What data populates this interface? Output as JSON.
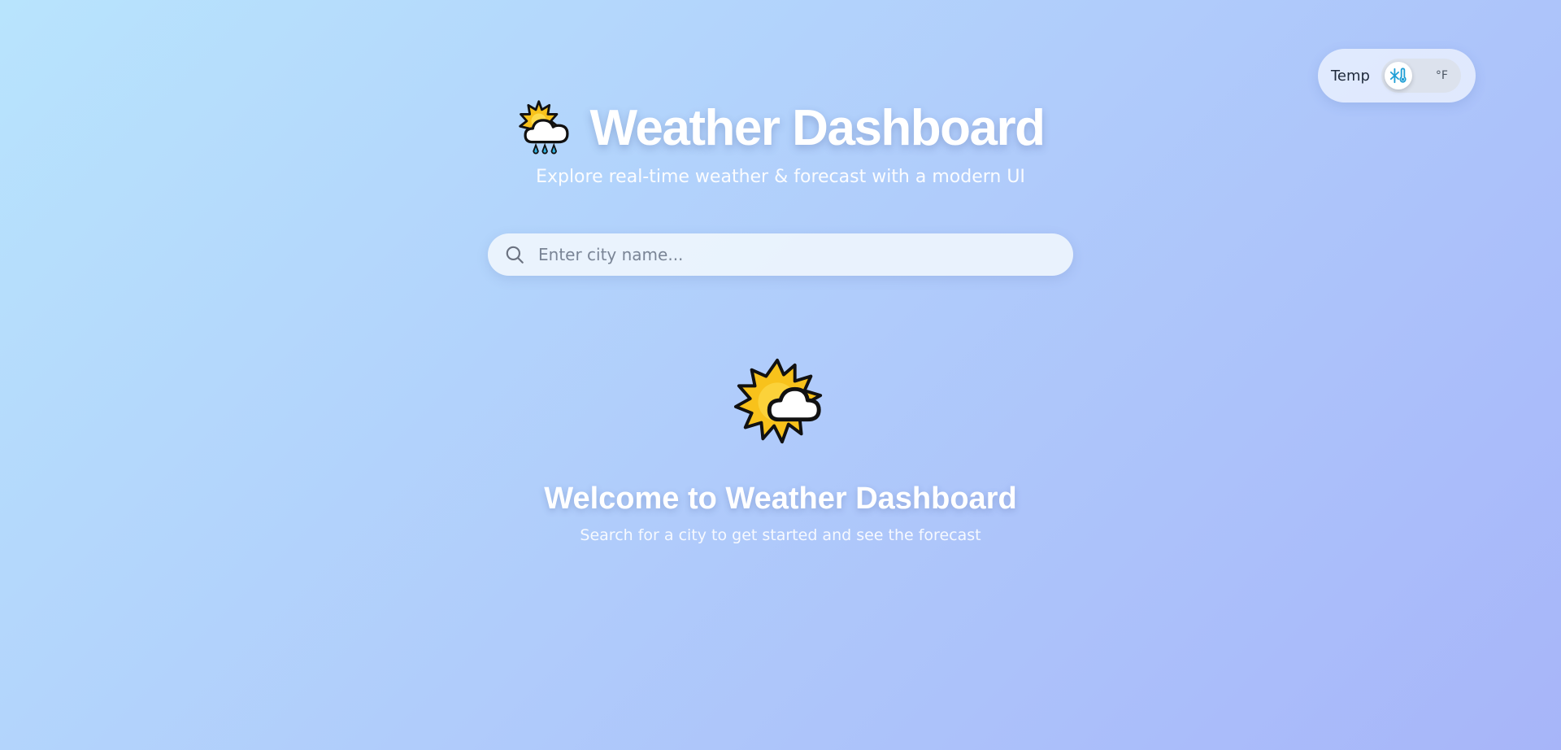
{
  "header": {
    "icon": "sun-behind-rain-cloud-icon",
    "title": "Weather Dashboard",
    "subtitle": "Explore real-time weather & forecast with a modern UI"
  },
  "temp_toggle": {
    "label": "Temp",
    "knob_icon": "snowflake-thermometer-icon",
    "alt_unit": "°F"
  },
  "search": {
    "icon": "search-icon",
    "placeholder": "Enter city name...",
    "value": ""
  },
  "welcome": {
    "icon": "sun-behind-cloud-icon",
    "title": "Welcome to Weather Dashboard",
    "text": "Search for a city to get started and see the forecast"
  },
  "colors": {
    "background_start": "#b8e4fd",
    "background_end": "#a7b5f9",
    "sun": "#f8c21b",
    "cloud": "#ffffff",
    "outline": "#111111",
    "rain": "#33b5e5",
    "knob_icon": "#1f9fd6"
  }
}
